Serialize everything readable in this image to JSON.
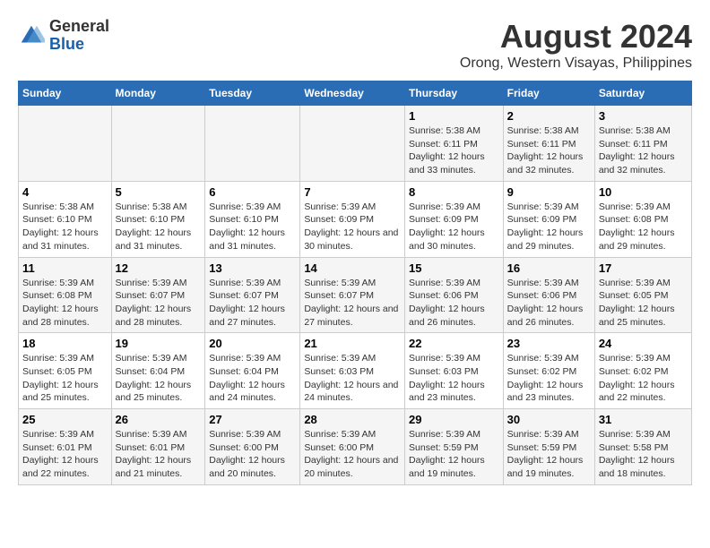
{
  "logo": {
    "general": "General",
    "blue": "Blue"
  },
  "title": "August 2024",
  "subtitle": "Orong, Western Visayas, Philippines",
  "weekdays": [
    "Sunday",
    "Monday",
    "Tuesday",
    "Wednesday",
    "Thursday",
    "Friday",
    "Saturday"
  ],
  "weeks": [
    [
      {
        "day": "",
        "info": ""
      },
      {
        "day": "",
        "info": ""
      },
      {
        "day": "",
        "info": ""
      },
      {
        "day": "",
        "info": ""
      },
      {
        "day": "1",
        "sunrise": "5:38 AM",
        "sunset": "6:11 PM",
        "daylight": "12 hours and 33 minutes."
      },
      {
        "day": "2",
        "sunrise": "5:38 AM",
        "sunset": "6:11 PM",
        "daylight": "12 hours and 32 minutes."
      },
      {
        "day": "3",
        "sunrise": "5:38 AM",
        "sunset": "6:11 PM",
        "daylight": "12 hours and 32 minutes."
      }
    ],
    [
      {
        "day": "4",
        "sunrise": "5:38 AM",
        "sunset": "6:10 PM",
        "daylight": "12 hours and 31 minutes."
      },
      {
        "day": "5",
        "sunrise": "5:38 AM",
        "sunset": "6:10 PM",
        "daylight": "12 hours and 31 minutes."
      },
      {
        "day": "6",
        "sunrise": "5:39 AM",
        "sunset": "6:10 PM",
        "daylight": "12 hours and 31 minutes."
      },
      {
        "day": "7",
        "sunrise": "5:39 AM",
        "sunset": "6:09 PM",
        "daylight": "12 hours and 30 minutes."
      },
      {
        "day": "8",
        "sunrise": "5:39 AM",
        "sunset": "6:09 PM",
        "daylight": "12 hours and 30 minutes."
      },
      {
        "day": "9",
        "sunrise": "5:39 AM",
        "sunset": "6:09 PM",
        "daylight": "12 hours and 29 minutes."
      },
      {
        "day": "10",
        "sunrise": "5:39 AM",
        "sunset": "6:08 PM",
        "daylight": "12 hours and 29 minutes."
      }
    ],
    [
      {
        "day": "11",
        "sunrise": "5:39 AM",
        "sunset": "6:08 PM",
        "daylight": "12 hours and 28 minutes."
      },
      {
        "day": "12",
        "sunrise": "5:39 AM",
        "sunset": "6:07 PM",
        "daylight": "12 hours and 28 minutes."
      },
      {
        "day": "13",
        "sunrise": "5:39 AM",
        "sunset": "6:07 PM",
        "daylight": "12 hours and 27 minutes."
      },
      {
        "day": "14",
        "sunrise": "5:39 AM",
        "sunset": "6:07 PM",
        "daylight": "12 hours and 27 minutes."
      },
      {
        "day": "15",
        "sunrise": "5:39 AM",
        "sunset": "6:06 PM",
        "daylight": "12 hours and 26 minutes."
      },
      {
        "day": "16",
        "sunrise": "5:39 AM",
        "sunset": "6:06 PM",
        "daylight": "12 hours and 26 minutes."
      },
      {
        "day": "17",
        "sunrise": "5:39 AM",
        "sunset": "6:05 PM",
        "daylight": "12 hours and 25 minutes."
      }
    ],
    [
      {
        "day": "18",
        "sunrise": "5:39 AM",
        "sunset": "6:05 PM",
        "daylight": "12 hours and 25 minutes."
      },
      {
        "day": "19",
        "sunrise": "5:39 AM",
        "sunset": "6:04 PM",
        "daylight": "12 hours and 25 minutes."
      },
      {
        "day": "20",
        "sunrise": "5:39 AM",
        "sunset": "6:04 PM",
        "daylight": "12 hours and 24 minutes."
      },
      {
        "day": "21",
        "sunrise": "5:39 AM",
        "sunset": "6:03 PM",
        "daylight": "12 hours and 24 minutes."
      },
      {
        "day": "22",
        "sunrise": "5:39 AM",
        "sunset": "6:03 PM",
        "daylight": "12 hours and 23 minutes."
      },
      {
        "day": "23",
        "sunrise": "5:39 AM",
        "sunset": "6:02 PM",
        "daylight": "12 hours and 23 minutes."
      },
      {
        "day": "24",
        "sunrise": "5:39 AM",
        "sunset": "6:02 PM",
        "daylight": "12 hours and 22 minutes."
      }
    ],
    [
      {
        "day": "25",
        "sunrise": "5:39 AM",
        "sunset": "6:01 PM",
        "daylight": "12 hours and 22 minutes."
      },
      {
        "day": "26",
        "sunrise": "5:39 AM",
        "sunset": "6:01 PM",
        "daylight": "12 hours and 21 minutes."
      },
      {
        "day": "27",
        "sunrise": "5:39 AM",
        "sunset": "6:00 PM",
        "daylight": "12 hours and 20 minutes."
      },
      {
        "day": "28",
        "sunrise": "5:39 AM",
        "sunset": "6:00 PM",
        "daylight": "12 hours and 20 minutes."
      },
      {
        "day": "29",
        "sunrise": "5:39 AM",
        "sunset": "5:59 PM",
        "daylight": "12 hours and 19 minutes."
      },
      {
        "day": "30",
        "sunrise": "5:39 AM",
        "sunset": "5:59 PM",
        "daylight": "12 hours and 19 minutes."
      },
      {
        "day": "31",
        "sunrise": "5:39 AM",
        "sunset": "5:58 PM",
        "daylight": "12 hours and 18 minutes."
      }
    ]
  ],
  "labels": {
    "sunrise": "Sunrise:",
    "sunset": "Sunset:",
    "daylight": "Daylight:"
  }
}
